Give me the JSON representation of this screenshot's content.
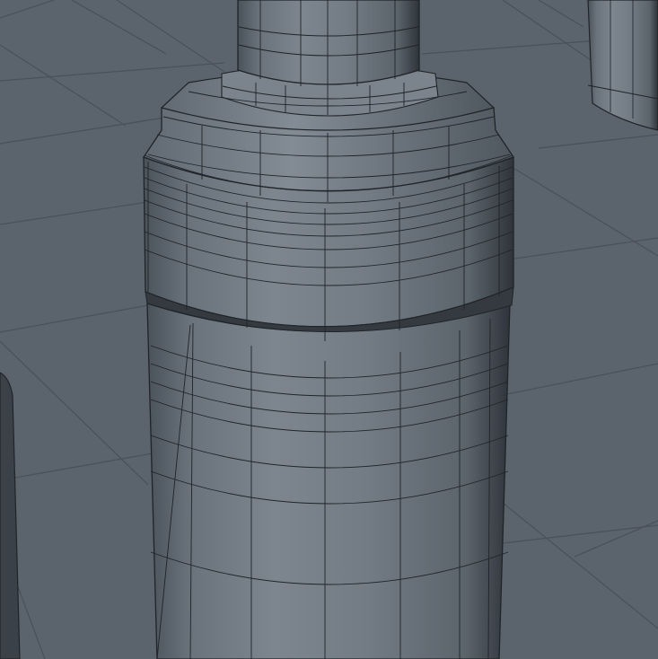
{
  "scene": {
    "kind": "3d-viewport-wireframe",
    "subject": "cylindrical-bottle-mesh",
    "colors": {
      "background": "#5b646d",
      "grid_line": "#4a5159",
      "mesh_light": "#7b858f",
      "mesh_mid": "#6a737c",
      "mesh_dark": "#3e454c",
      "wire": "#1f2428"
    }
  }
}
